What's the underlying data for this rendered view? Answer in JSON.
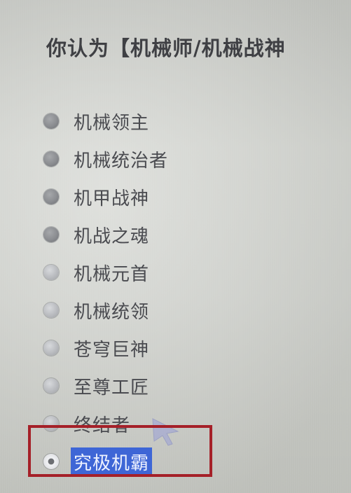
{
  "question": {
    "text": "你认为【机械师/机械战神"
  },
  "options": [
    {
      "label": "机械领主",
      "selected": false
    },
    {
      "label": "机械统治者",
      "selected": false
    },
    {
      "label": "机甲战神",
      "selected": false
    },
    {
      "label": "机战之魂",
      "selected": false
    },
    {
      "label": "机械元首",
      "selected": false
    },
    {
      "label": "机械统领",
      "selected": false
    },
    {
      "label": "苍穹巨神",
      "selected": false
    },
    {
      "label": "至尊工匠",
      "selected": false
    },
    {
      "label": "终结者",
      "selected": false
    },
    {
      "label": "究极机霸",
      "selected": true
    }
  ],
  "colors": {
    "selection_bg": "#3e66d6",
    "annotation_box": "#a52028"
  }
}
